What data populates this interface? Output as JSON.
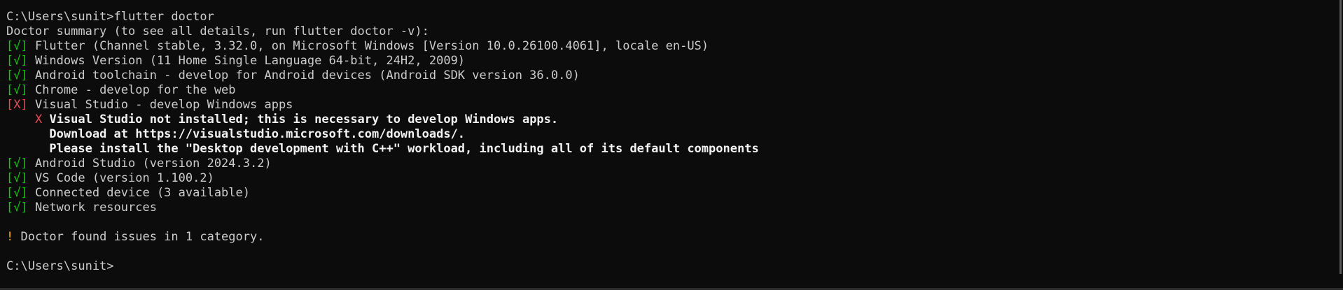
{
  "terminal": {
    "command_line": "C:\\Users\\sunit>flutter doctor",
    "summary": "Doctor summary (to see all details, run flutter doctor -v):",
    "checks": [
      {
        "status": "[√]",
        "text": " Flutter (Channel stable, 3.32.0, on Microsoft Windows [Version 10.0.26100.4061], locale en-US)"
      },
      {
        "status": "[√]",
        "text": " Windows Version (11 Home Single Language 64-bit, 24H2, 2009)"
      },
      {
        "status": "[√]",
        "text": " Android toolchain - develop for Android devices (Android SDK version 36.0.0)"
      },
      {
        "status": "[√]",
        "text": " Chrome - develop for the web"
      },
      {
        "status": "[X]",
        "text": " Visual Studio - develop Windows apps"
      },
      {
        "status": "[√]",
        "text": " Android Studio (version 2024.3.2)"
      },
      {
        "status": "[√]",
        "text": " VS Code (version 1.100.2)"
      },
      {
        "status": "[√]",
        "text": " Connected device (3 available)"
      },
      {
        "status": "[√]",
        "text": " Network resources"
      }
    ],
    "vs_details": {
      "marker": "X",
      "not_installed": "Visual Studio not installed; this is necessary to develop Windows apps.",
      "download": "Download at https://visualstudio.microsoft.com/downloads/.",
      "install": "Please install the \"Desktop development with C++\" workload, including all of its default components"
    },
    "issues": {
      "marker": "!",
      "text": " Doctor found issues in 1 category."
    },
    "prompt": "C:\\Users\\sunit>"
  },
  "colors": {
    "background": "#0c0c0c",
    "text": "#cccccc",
    "ok": "#16c60c",
    "error": "#e74856",
    "warning": "#f9b31b",
    "bright_text": "#f2f2f2"
  }
}
